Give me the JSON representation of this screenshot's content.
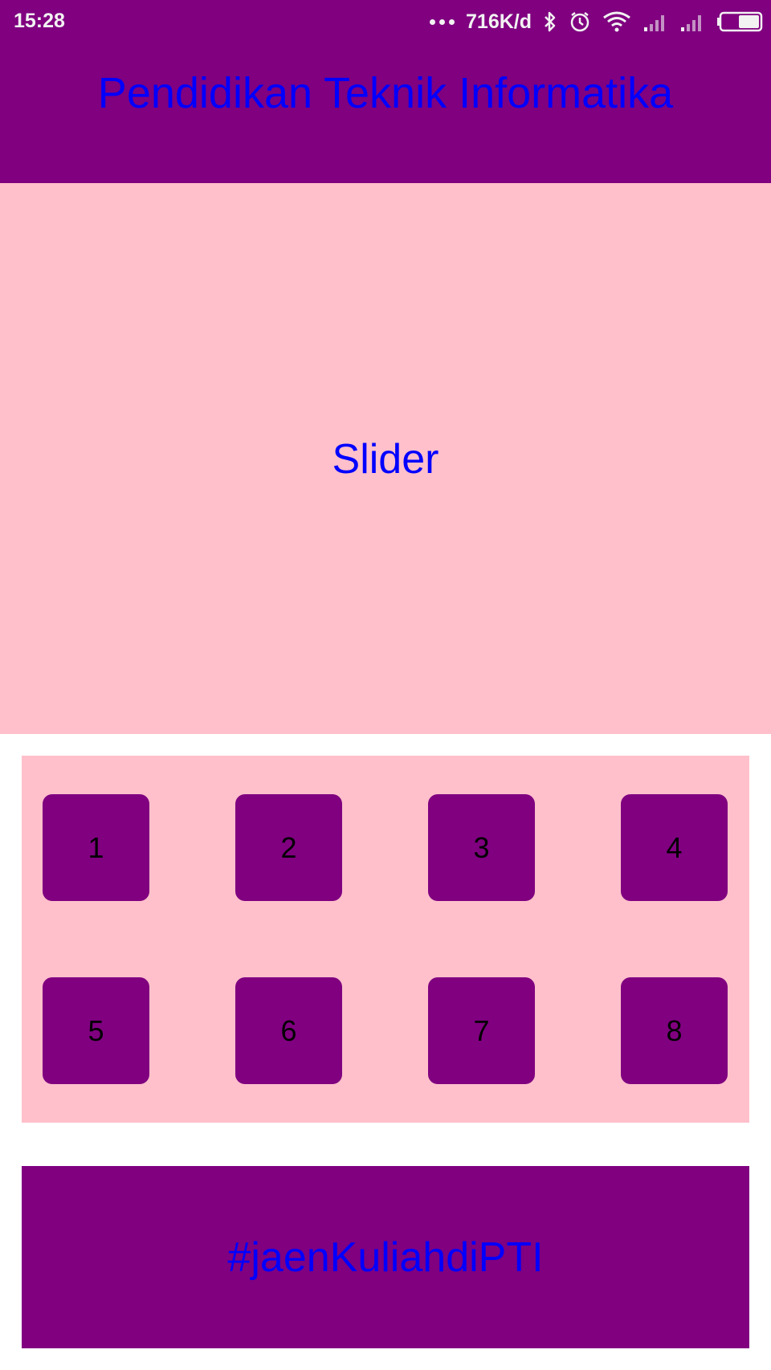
{
  "status_bar": {
    "time": "15:28",
    "net_speed": "716K/d",
    "icons": [
      "more-dots-icon",
      "bluetooth-icon",
      "alarm-icon",
      "wifi-icon",
      "signal-1-icon",
      "signal-2-icon",
      "battery-icon"
    ]
  },
  "header": {
    "title": "Pendidikan Teknik Informatika"
  },
  "slider": {
    "label": "Slider"
  },
  "menu": {
    "tiles": [
      "1",
      "2",
      "3",
      "4",
      "5",
      "6",
      "7",
      "8"
    ]
  },
  "footer": {
    "label": "#jaenKuliahdiPTI"
  },
  "colors": {
    "primary": "#800080",
    "secondary": "#ffc0cb",
    "text_accent": "#0000ff",
    "background": "#ffffff"
  }
}
